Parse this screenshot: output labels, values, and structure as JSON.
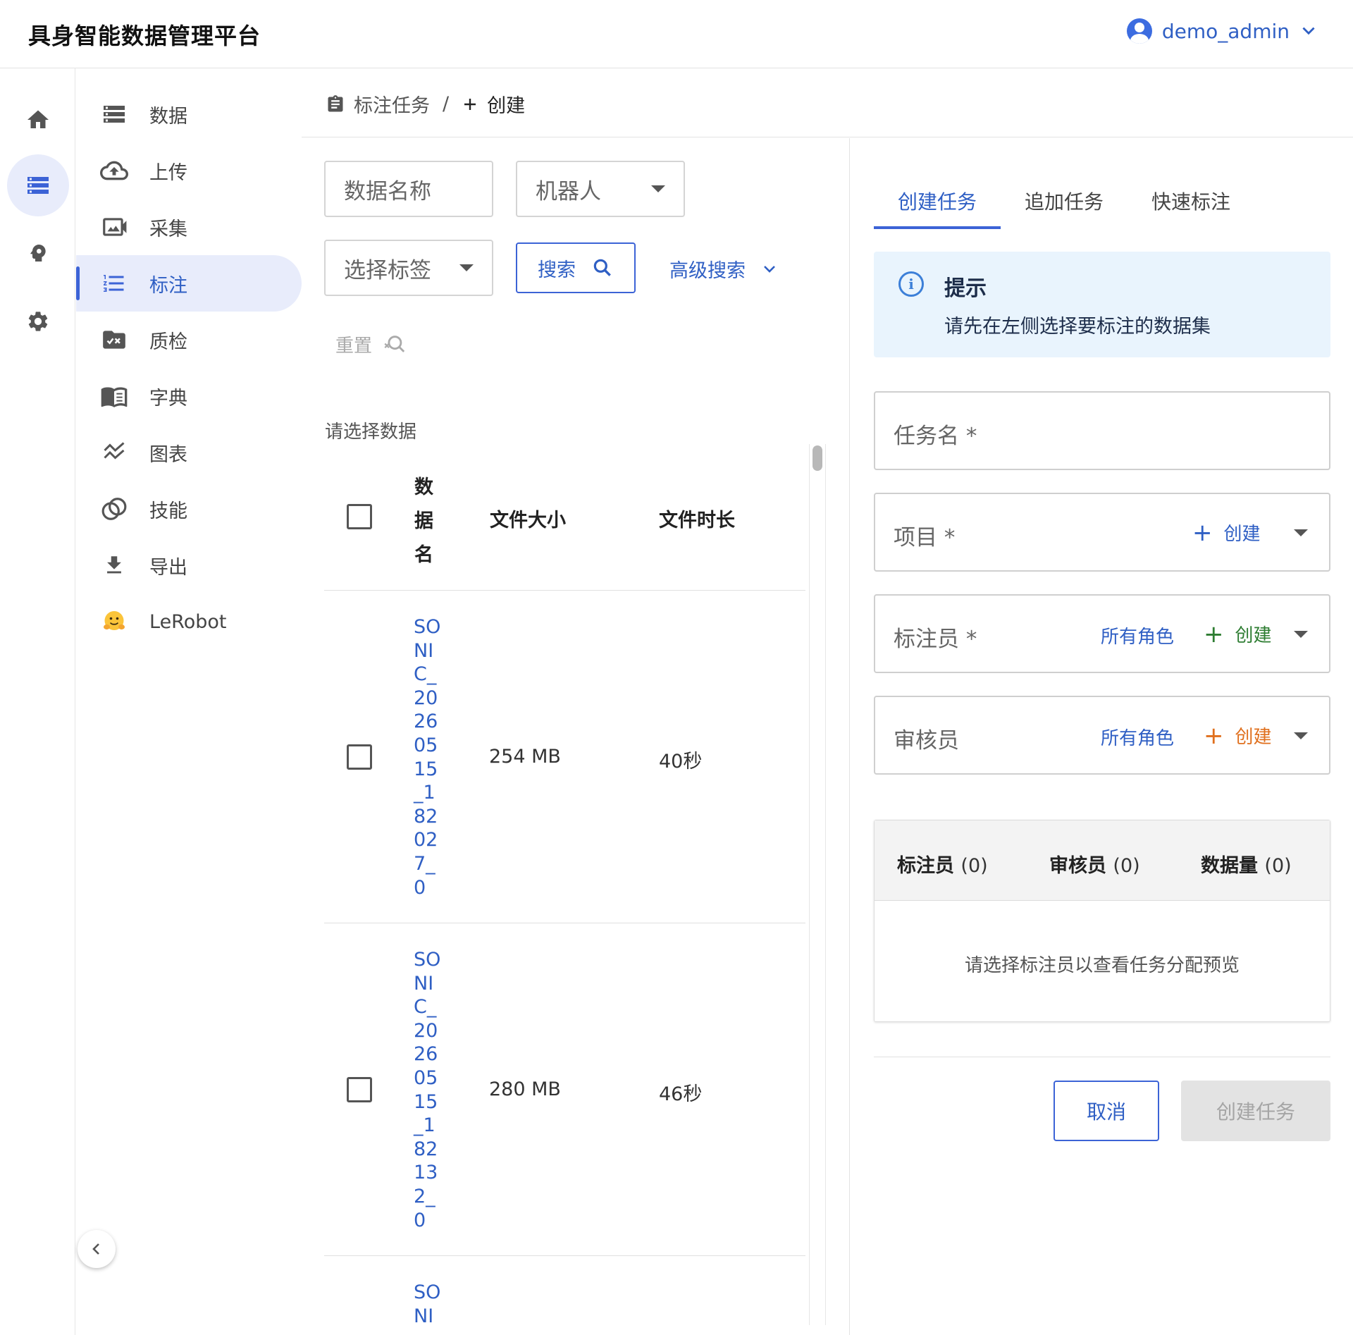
{
  "app": {
    "title": "具身智能数据管理平台"
  },
  "user": {
    "name": "demo_admin"
  },
  "rail": {
    "items": [
      "home-icon",
      "storage-icon",
      "psychology-icon",
      "settings-icon"
    ],
    "active": 1
  },
  "nav": {
    "items": [
      {
        "label": "数据",
        "icon": "list-storage-icon"
      },
      {
        "label": "上传",
        "icon": "cloud-upload-icon"
      },
      {
        "label": "采集",
        "icon": "video-camera-icon"
      },
      {
        "label": "标注",
        "icon": "format-list-icon"
      },
      {
        "label": "质检",
        "icon": "folder-check-icon"
      },
      {
        "label": "字典",
        "icon": "book-icon"
      },
      {
        "label": "图表",
        "icon": "chart-line-icon"
      },
      {
        "label": "技能",
        "icon": "rings-icon"
      },
      {
        "label": "导出",
        "icon": "download-icon"
      },
      {
        "label": "LeRobot",
        "icon": "hugging-face-icon"
      }
    ],
    "active_index": 3
  },
  "breadcrumb": {
    "parent": "标注任务",
    "separator": "/",
    "current": "创建"
  },
  "filters": {
    "data_name_placeholder": "数据名称",
    "robot_placeholder": "机器人",
    "tag_placeholder": "选择标签",
    "search_label": "搜索",
    "advanced_label": "高级搜索",
    "reset_label": "重置"
  },
  "table": {
    "section_label": "请选择数据",
    "columns": {
      "name": "数据名",
      "size": "文件大小",
      "duration": "文件时长"
    },
    "rows": [
      {
        "name": "SONIC_20260515_182027_0",
        "size": "254 MB",
        "duration": "40秒"
      },
      {
        "name": "SONIC_20260515_182132_0",
        "size": "280 MB",
        "duration": "46秒"
      },
      {
        "name": "SONI",
        "size": "",
        "duration": ""
      }
    ]
  },
  "tabs": {
    "items": [
      "创建任务",
      "追加任务",
      "快速标注"
    ],
    "active_index": 0
  },
  "info": {
    "title": "提示",
    "text": "请先在左侧选择要标注的数据集",
    "icon_glyph": "i"
  },
  "form": {
    "task_name_label": "任务名 *",
    "project_label": "项目 *",
    "annotator_label": "标注员 *",
    "reviewer_label": "审核员",
    "all_roles": "所有角色",
    "create_label": "创建",
    "colors": {
      "project_create": "#2f5fc4",
      "annotator_create": "#2e7d32",
      "reviewer_create": "#e0701e"
    }
  },
  "summary": {
    "annotators_label": "标注员",
    "annotators_count": "(0)",
    "reviewers_label": "审核员",
    "reviewers_count": "(0)",
    "data_label": "数据量",
    "data_count": "(0)",
    "empty_text": "请选择标注员以查看任务分配预览"
  },
  "actions": {
    "cancel": "取消",
    "create_task": "创建任务"
  },
  "accent_color": "#3c63d6"
}
